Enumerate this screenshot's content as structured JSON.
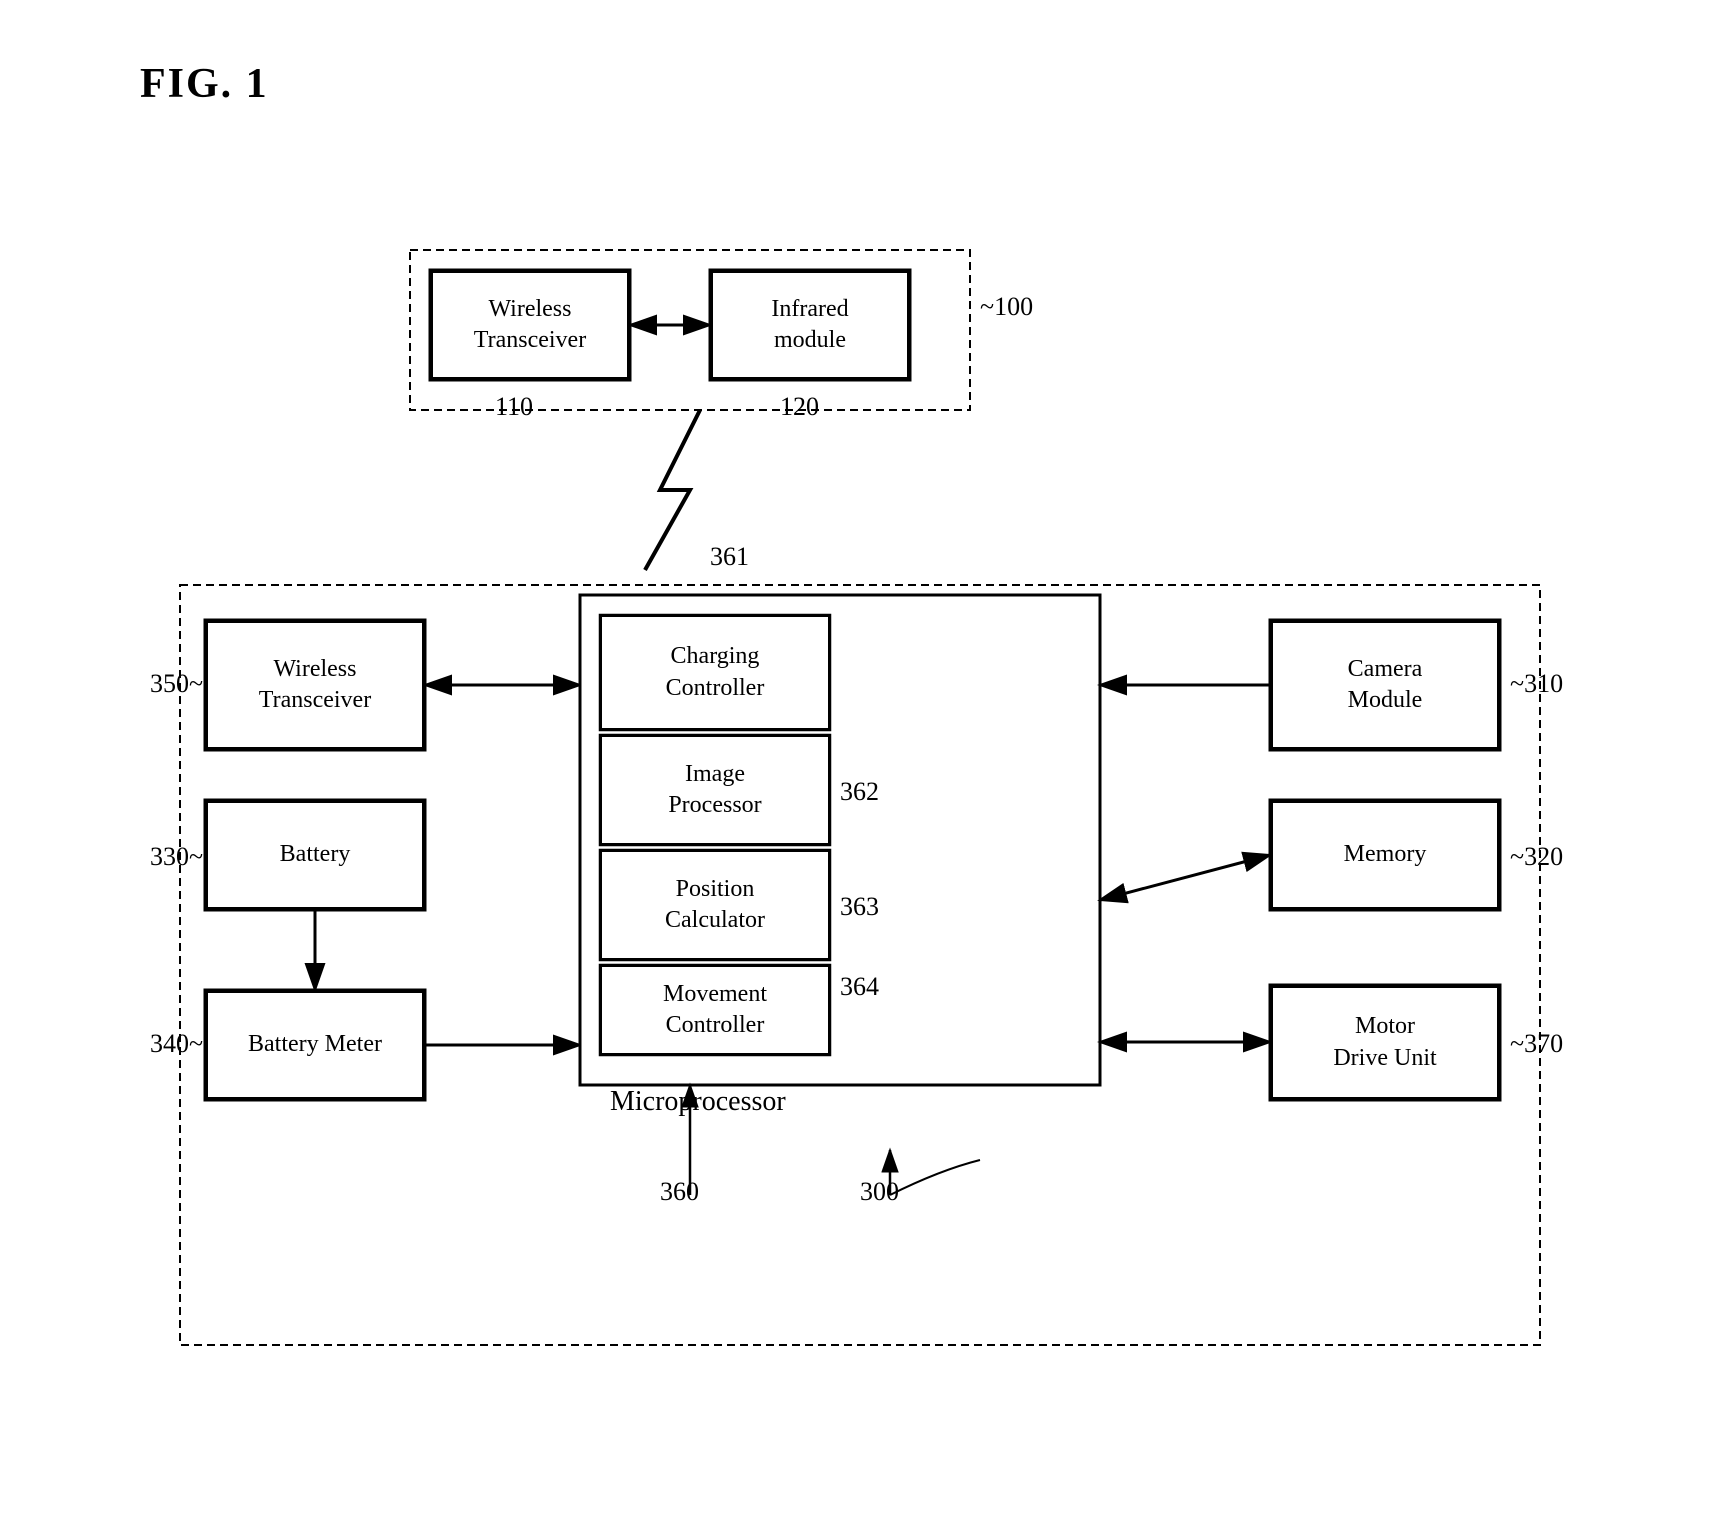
{
  "title": "FIG. 1",
  "diagram": {
    "top_module": {
      "label": "100",
      "wireless_transceiver": "Wireless\nTransceiver",
      "infrared_module": "Infrared\nmodule",
      "label_110": "110",
      "label_120": "120"
    },
    "main_module": {
      "label": "300",
      "wireless_transceiver": "Wireless\nTransceiver",
      "label_350": "350",
      "battery": "Battery",
      "label_330": "330",
      "battery_meter": "Battery Meter",
      "label_340": "340",
      "camera_module": "Camera\nModule",
      "label_310": "310",
      "memory": "Memory",
      "label_320": "320",
      "motor_drive_unit": "Motor\nDrive Unit",
      "label_370": "370",
      "microprocessor": "Microprocessor",
      "label_360": "360",
      "inner_box": {
        "charging_controller": "Charging\nController",
        "image_processor": "Image\nProcessor",
        "position_calculator": "Position\nCalculator",
        "movement_controller": "Movement\nController",
        "label_362": "362",
        "label_363": "363",
        "label_364": "364",
        "label_361": "361"
      }
    }
  }
}
